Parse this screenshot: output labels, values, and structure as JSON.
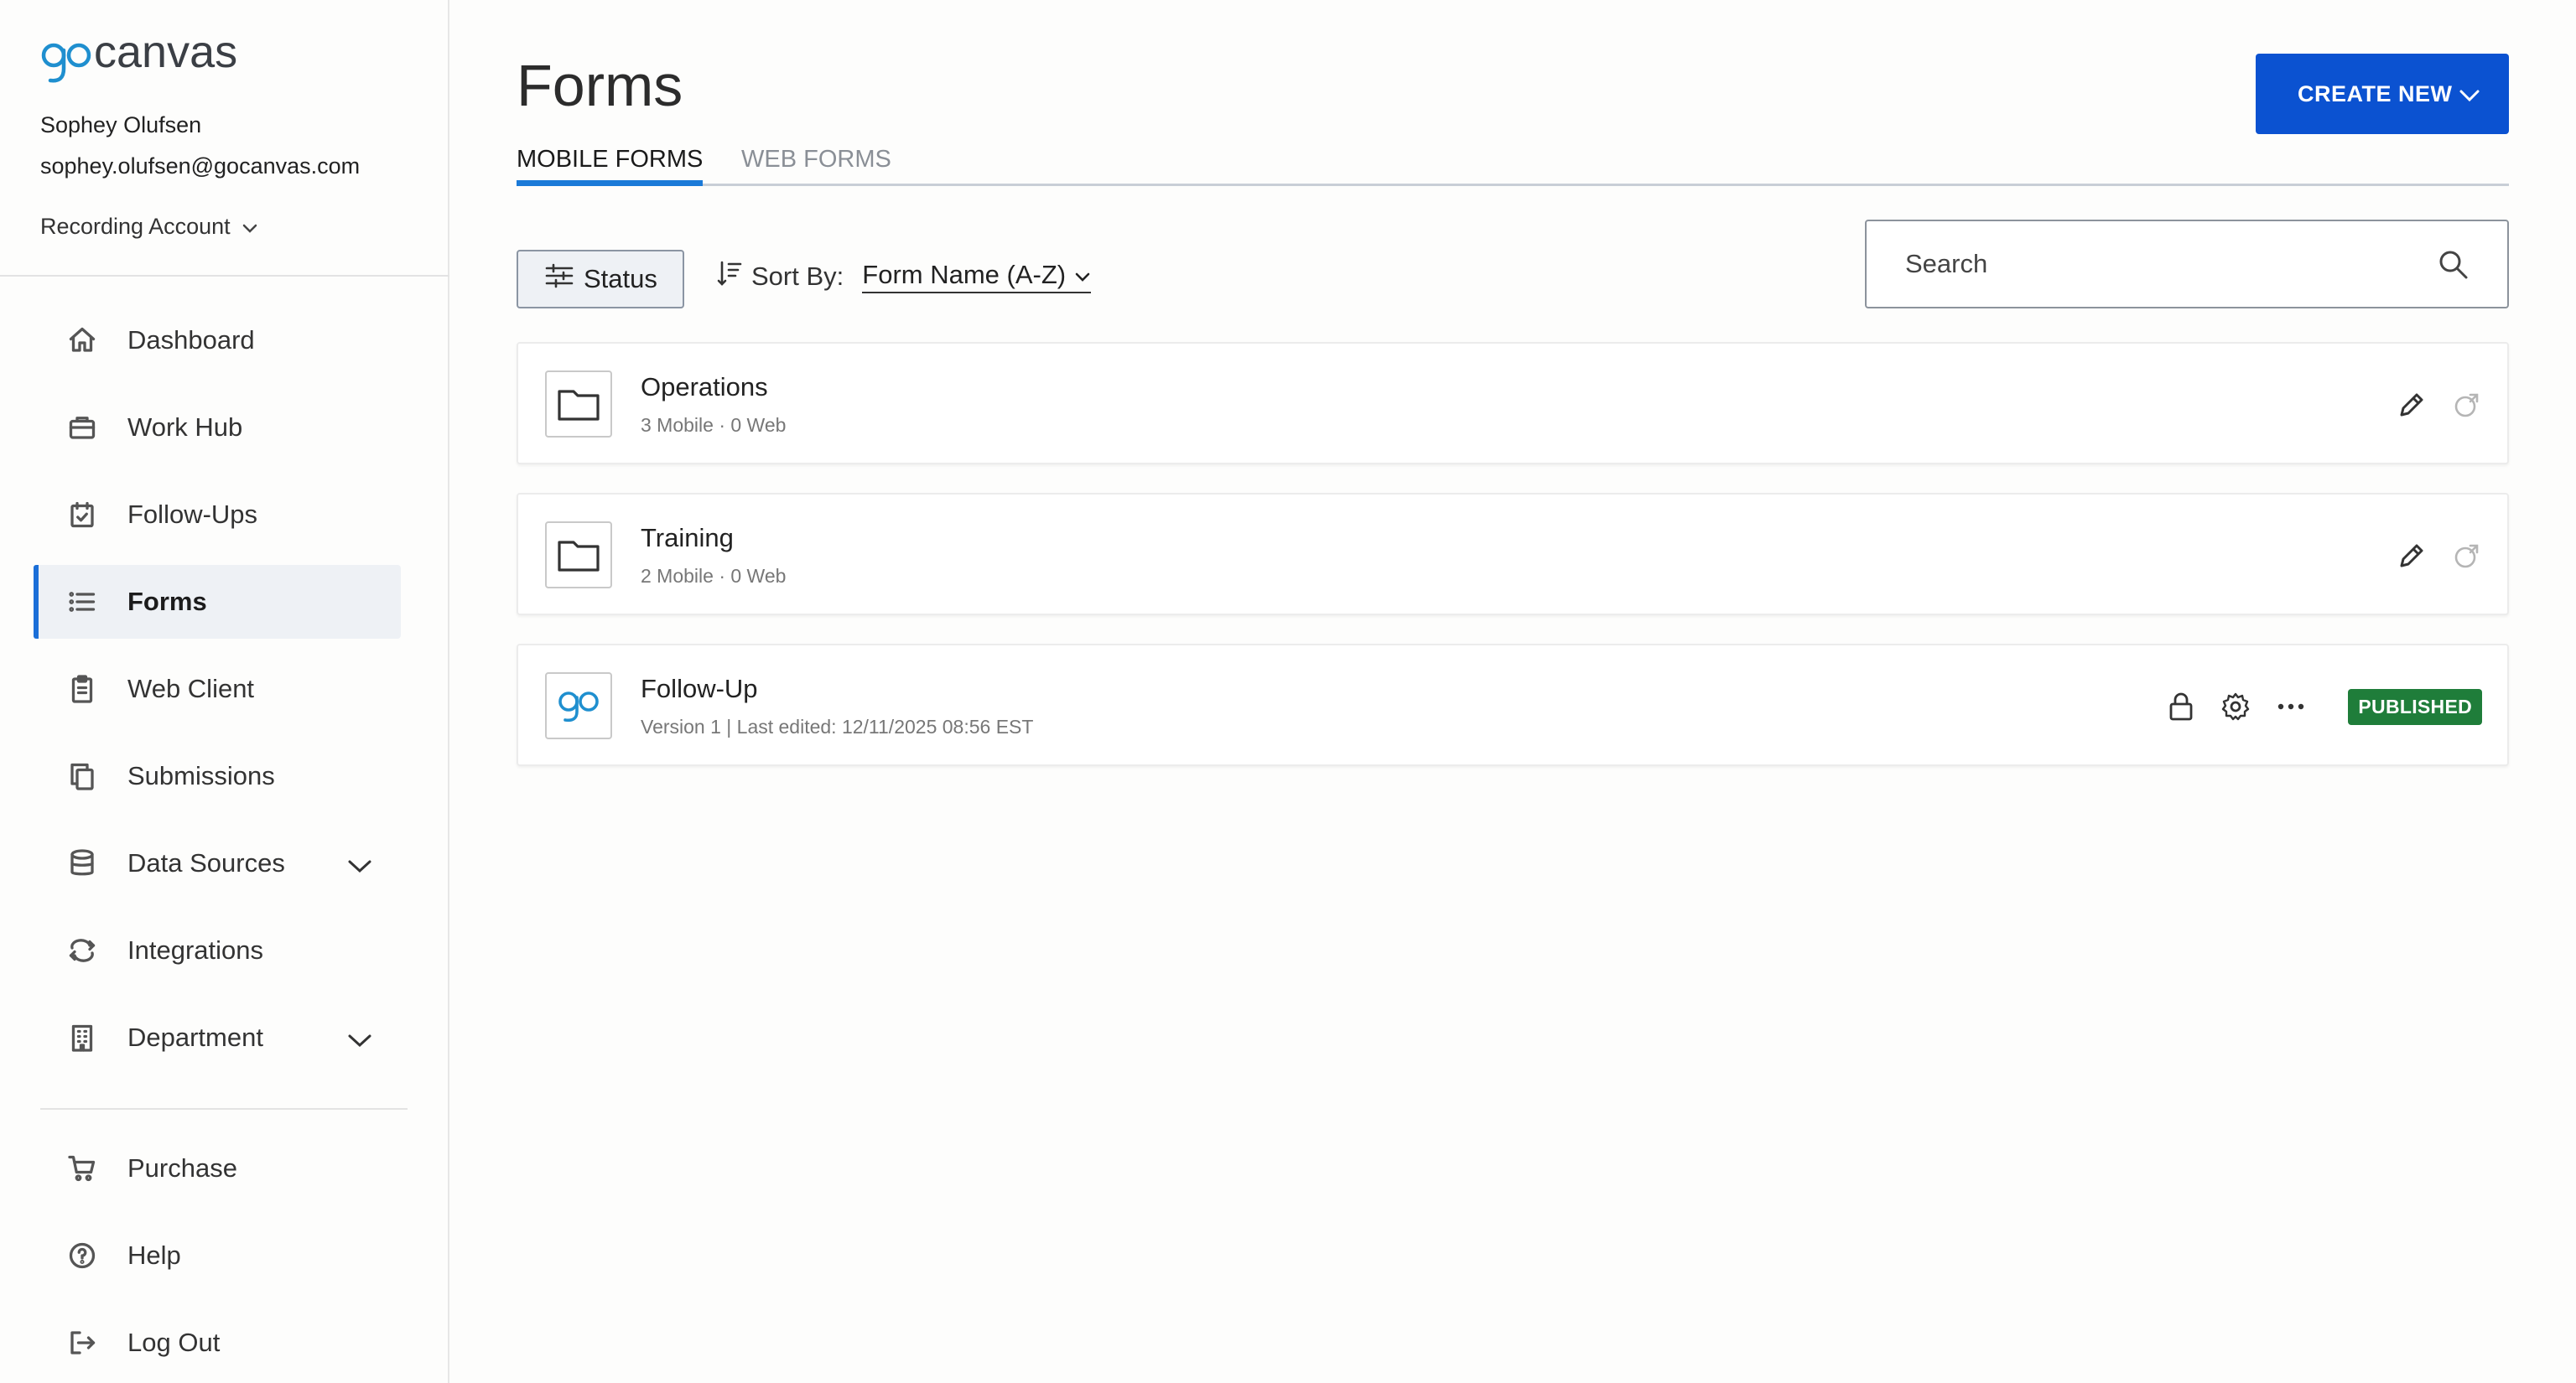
{
  "brand": {
    "logo_text": "gocanvas",
    "accent_color": "#0b52d1",
    "logo_color": "#1f8fcf"
  },
  "user": {
    "name": "Sophey Olufsen",
    "email": "sophey.olufsen@gocanvas.com",
    "account_label": "Recording Account"
  },
  "sidebar": {
    "items": [
      {
        "label": "Dashboard",
        "icon": "home-icon"
      },
      {
        "label": "Work Hub",
        "icon": "briefcase-icon"
      },
      {
        "label": "Follow-Ups",
        "icon": "calendar-check-icon"
      },
      {
        "label": "Forms",
        "icon": "list-icon",
        "active": true
      },
      {
        "label": "Web Client",
        "icon": "clipboard-icon"
      },
      {
        "label": "Submissions",
        "icon": "copy-icon"
      },
      {
        "label": "Data Sources",
        "icon": "database-icon",
        "expandable": true
      },
      {
        "label": "Integrations",
        "icon": "sync-icon"
      },
      {
        "label": "Department",
        "icon": "building-icon",
        "expandable": true
      }
    ],
    "bottom_items": [
      {
        "label": "Purchase",
        "icon": "cart-icon"
      },
      {
        "label": "Help",
        "icon": "help-circle-icon"
      },
      {
        "label": "Log Out",
        "icon": "logout-icon"
      }
    ]
  },
  "main": {
    "title": "Forms",
    "create_button": "CREATE NEW",
    "tabs": [
      {
        "label": "MOBILE FORMS",
        "active": true
      },
      {
        "label": "WEB FORMS",
        "active": false
      }
    ],
    "status_button": "Status",
    "sort": {
      "label": "Sort By:",
      "value": "Form Name (A-Z)"
    },
    "search": {
      "placeholder": "Search",
      "value": ""
    },
    "rows": [
      {
        "type": "folder",
        "title": "Operations",
        "subtitle": "3 Mobile · 0 Web"
      },
      {
        "type": "folder",
        "title": "Training",
        "subtitle": "2 Mobile · 0 Web"
      },
      {
        "type": "form",
        "title": "Follow-Up",
        "subtitle": "Version 1 | Last edited: 12/11/2025 08:56 EST",
        "status": "PUBLISHED",
        "status_color": "#1f7d3a"
      }
    ]
  }
}
